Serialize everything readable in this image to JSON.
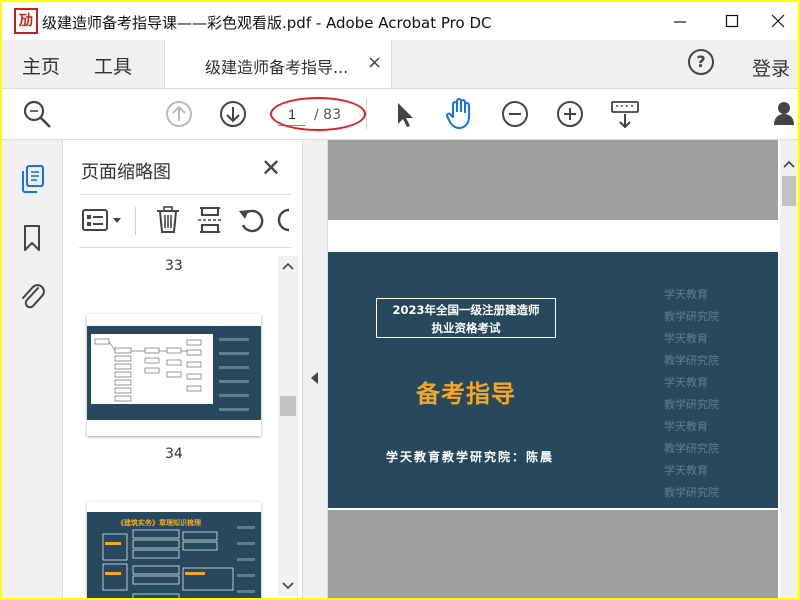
{
  "window": {
    "title": "级建造师备考指导课——彩色观看版.pdf - Adobe Acrobat Pro DC",
    "app_icon_glyph": "劢",
    "controls": {
      "minimize": "—",
      "maximize": "☐",
      "close": "✕"
    }
  },
  "menubar": {
    "home": "主页",
    "tools": "工具",
    "tab": {
      "label": "级建造师备考指导...",
      "close": "×"
    },
    "help": "?",
    "login": "登录"
  },
  "toolbar": {
    "page_current": "1",
    "page_total": "/ 83",
    "icons": [
      "search-zoom-icon",
      "prev-page-icon",
      "next-page-icon",
      "select-arrow-icon",
      "hand-tool-icon",
      "zoom-out-icon",
      "zoom-in-icon",
      "scroll-mode-icon",
      "share-user-icon"
    ]
  },
  "thumbnail_panel": {
    "title": "页面缩略图",
    "close": "✕",
    "page_labels": [
      "33",
      "34"
    ],
    "thumb2_heading": "《建筑实务》章理知识梳理"
  },
  "document": {
    "slide": {
      "box_line1": "2023年全国一级注册建造师",
      "box_line2": "执业资格考试",
      "headline": "备考指导",
      "author": "学天教育教学研究院：陈晨",
      "watermark_a": "学天教育",
      "watermark_b": "教学研究院"
    }
  },
  "colors": {
    "highlight_border": "#ffff00",
    "annotation_oval": "#e02020",
    "slide_bg": "#26495e",
    "headline": "#f5a623",
    "accent_blue": "#1473e6"
  }
}
